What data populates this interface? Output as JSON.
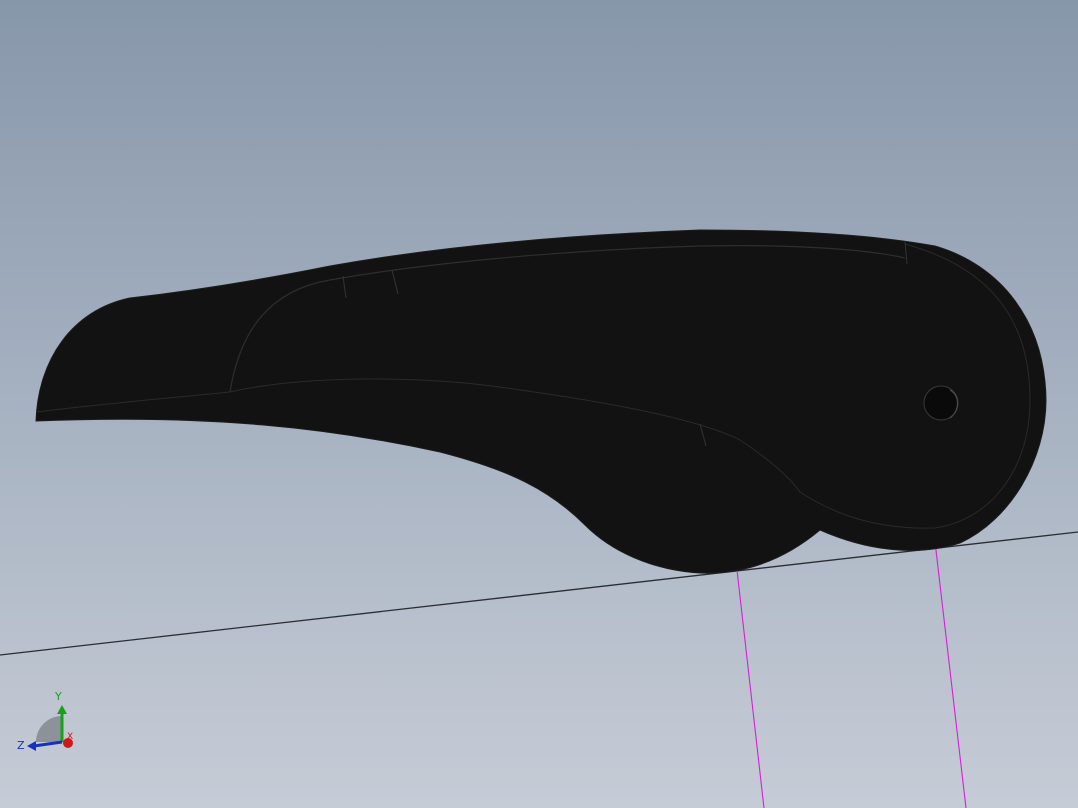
{
  "viewport": {
    "background_top": "#8797aa",
    "background_bottom": "#c6ccd6"
  },
  "model": {
    "name": "lever-body",
    "color": "#121212",
    "edge_color": "#2c2c2c"
  },
  "ground_line": {
    "color": "#2a2d33"
  },
  "sketch_lines": {
    "color": "#d81ed8"
  },
  "triad": {
    "x_label": "X",
    "y_label": "Y",
    "z_label": "Z",
    "x_color": "#d01818",
    "y_color": "#18a018",
    "z_color": "#1830c0"
  }
}
